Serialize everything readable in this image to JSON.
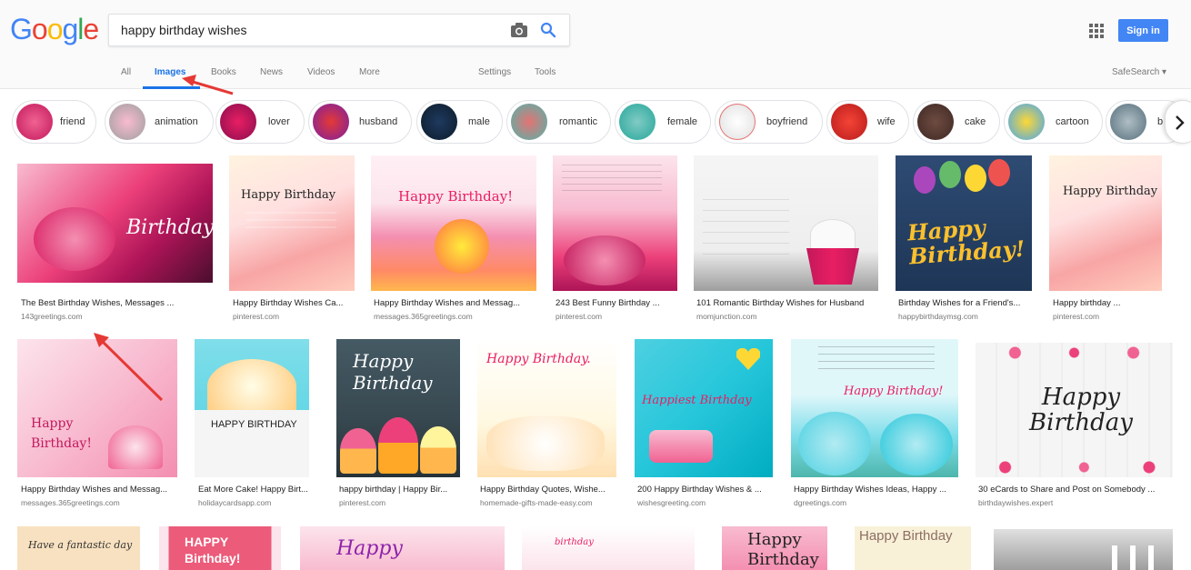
{
  "logo": {
    "text": "Google"
  },
  "search": {
    "query": "happy birthday wishes"
  },
  "header": {
    "signin_label": "Sign in"
  },
  "tabs": {
    "all": "All",
    "images": "Images",
    "books": "Books",
    "news": "News",
    "videos": "Videos",
    "more": "More",
    "settings": "Settings",
    "tools": "Tools",
    "safesearch": "SafeSearch ▾"
  },
  "chips": [
    "friend",
    "animation",
    "lover",
    "husband",
    "male",
    "romantic",
    "female",
    "boyfriend",
    "wife",
    "cake",
    "cartoon",
    "b"
  ],
  "results": [
    {
      "title": "The Best Birthday Wishes, Messages ...",
      "source": "143greetings.com",
      "text": "Birthday"
    },
    {
      "title": "Happy Birthday Wishes Ca...",
      "source": "pinterest.com",
      "text": "Happy Birthday"
    },
    {
      "title": "Happy Birthday Wishes and Messag...",
      "source": "messages.365greetings.com",
      "text": "Happy Birthday!"
    },
    {
      "title": "243 Best Funny Birthday ...",
      "source": "pinterest.com",
      "text": ""
    },
    {
      "title": "101 Romantic Birthday Wishes for Husband",
      "source": "momjunction.com",
      "text": ""
    },
    {
      "title": "Birthday Wishes for a Friend's...",
      "source": "happybirthdaymsg.com",
      "text": "Happy Birthday!"
    },
    {
      "title": "Happy birthday ...",
      "source": "pinterest.com",
      "text": "Happy Birthday"
    },
    {
      "title": "Happy Birthday Wishes and Messag...",
      "source": "messages.365greetings.com",
      "text": "Happy Birthday!"
    },
    {
      "title": "Eat More Cake! Happy Birt...",
      "source": "holidaycardsapp.com",
      "text": "HAPPY BIRTHDAY"
    },
    {
      "title": "happy birthday | Happy Bir...",
      "source": "pinterest.com",
      "text": "Happy Birthday"
    },
    {
      "title": "Happy Birthday Quotes, Wishe...",
      "source": "homemade-gifts-made-easy.com",
      "text": "Happy Birthday."
    },
    {
      "title": "200 Happy Birthday Wishes & ...",
      "source": "wishesgreeting.com",
      "text": "Happiest Birthday"
    },
    {
      "title": "Happy Birthday Wishes Ideas, Happy ...",
      "source": "dgreetings.com",
      "text": "Happy Birthday!"
    },
    {
      "title": "30 eCards to Share and Post on Somebody ...",
      "source": "birthdaywishes.expert",
      "text": "Happy Birthday"
    },
    {
      "title": "",
      "source": "",
      "text": "Have a fantastic day"
    },
    {
      "title": "",
      "source": "",
      "text": "HAPPY Birthday!"
    },
    {
      "title": "",
      "source": "",
      "text": "Happy"
    },
    {
      "title": "",
      "source": "",
      "text": "birthday"
    },
    {
      "title": "",
      "source": "",
      "text": "Happy Birthday"
    },
    {
      "title": "",
      "source": "",
      "text": "Happy Birthday"
    },
    {
      "title": "",
      "source": "",
      "text": ""
    }
  ],
  "colors": {
    "accent": "#1a73e8",
    "signin": "#4285f4",
    "arrow": "#e53935"
  }
}
